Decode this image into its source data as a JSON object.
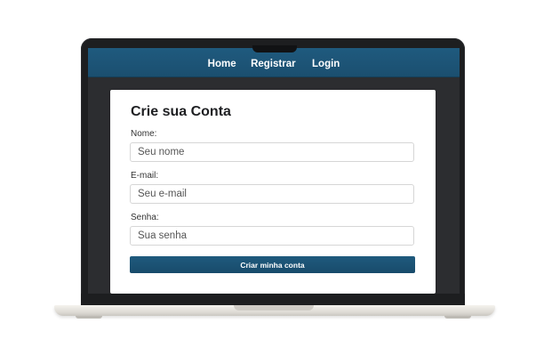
{
  "nav": {
    "items": [
      {
        "label": "Home"
      },
      {
        "label": "Registrar"
      },
      {
        "label": "Login"
      }
    ]
  },
  "form": {
    "title": "Crie sua Conta",
    "fields": [
      {
        "label": "Nome:",
        "placeholder": "Seu nome"
      },
      {
        "label": "E-mail:",
        "placeholder": "Seu e-mail"
      },
      {
        "label": "Senha:",
        "placeholder": "Sua senha"
      }
    ],
    "submit_label": "Criar minha conta"
  },
  "colors": {
    "navbar": "#1f5a7e",
    "button": "#1f5a7e",
    "laptop_bezel": "#1d1e20",
    "laptop_body": "#e8e6e1"
  }
}
